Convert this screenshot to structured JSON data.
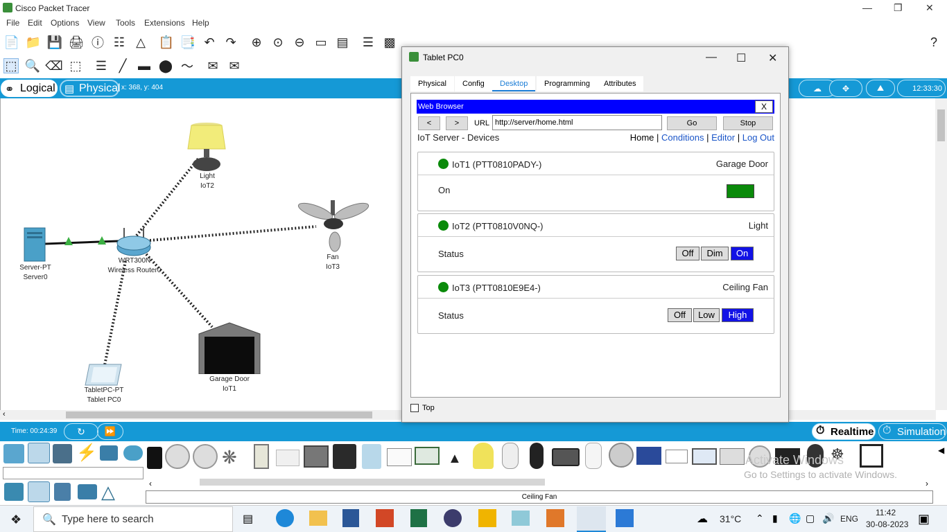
{
  "app": {
    "title": "Cisco Packet Tracer",
    "menu": [
      "File",
      "Edit",
      "Options",
      "View",
      "Tools",
      "Extensions",
      "Help"
    ]
  },
  "workspace": {
    "logical_tab": "Logical",
    "physical_tab": "Physical",
    "coords": "x: 368, y: 404",
    "clock": "12:33:30"
  },
  "devices": [
    {
      "line1": "Light",
      "line2": "IoT2"
    },
    {
      "line1": "Server-PT",
      "line2": "Server0"
    },
    {
      "line1": "WRT300N",
      "line2": "Wireless Router0"
    },
    {
      "line1": "Fan",
      "line2": "IoT3"
    },
    {
      "line1": "Garage Door",
      "line2": "IoT1"
    },
    {
      "line1": "TabletPC-PT",
      "line2": "Tablet PC0"
    }
  ],
  "timebar": {
    "time": "Time: 00:24:39",
    "realtime": "Realtime",
    "simulation": "Simulation"
  },
  "picker": {
    "selected_device": "Ceiling Fan",
    "watermark_line1": "Activate Windows",
    "watermark_line2": "Go to Settings to activate Windows."
  },
  "taskbar": {
    "search_placeholder": "Type here to search",
    "temperature": "31°C",
    "language": "ENG",
    "time": "11:42",
    "date": "30-08-2023"
  },
  "tablet": {
    "title": "Tablet PC0",
    "tabs": [
      "Physical",
      "Config",
      "Desktop",
      "Programming",
      "Attributes"
    ],
    "active_tab": "Desktop",
    "top_checkbox_label": "Top",
    "browser": {
      "title": "Web Browser",
      "close": "X",
      "back": "<",
      "forward": ">",
      "url_label": "URL",
      "url": "http://server/home.html",
      "go": "Go",
      "stop": "Stop",
      "page_heading": "IoT Server - Devices",
      "nav": {
        "home": "Home",
        "conditions": "Conditions",
        "editor": "Editor",
        "logout": "Log Out",
        "sep": "|"
      },
      "devices": [
        {
          "name": "IoT1 (PTT0810PADY-)",
          "type": "Garage Door",
          "field": "On",
          "status_color": "#0a8a0a",
          "control": "green-indicator"
        },
        {
          "name": "IoT2 (PTT0810V0NQ-)",
          "type": "Light",
          "field": "Status",
          "options": [
            "Off",
            "Dim",
            "On"
          ],
          "selected": "On"
        },
        {
          "name": "IoT3 (PTT0810E9E4-)",
          "type": "Ceiling Fan",
          "field": "Status",
          "options": [
            "Off",
            "Low",
            "High"
          ],
          "selected": "High"
        }
      ]
    }
  }
}
